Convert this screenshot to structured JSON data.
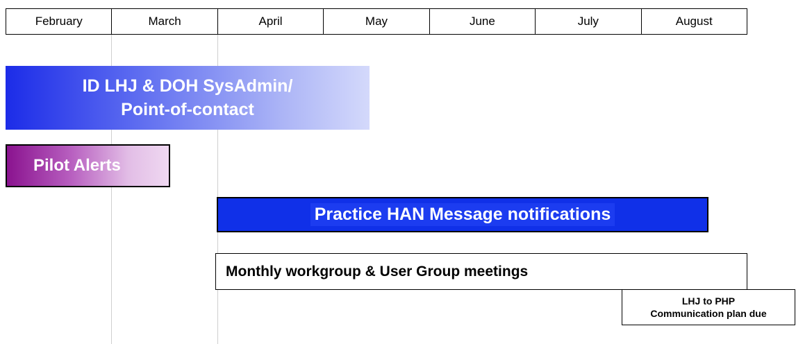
{
  "months": [
    "February",
    "March",
    "April",
    "May",
    "June",
    "July",
    "August"
  ],
  "tasks": {
    "sysadmin": {
      "line1": "ID LHJ & DOH SysAdmin/",
      "line2": "Point-of-contact"
    },
    "pilot": {
      "label": "Pilot Alerts"
    },
    "practice": {
      "label": "Practice HAN Message notifications"
    },
    "monthly": {
      "label": "Monthly workgroup & User Group meetings"
    },
    "communication": {
      "line1": "LHJ to PHP",
      "line2": "Communication plan due"
    }
  },
  "colors": {
    "sysadmin_start": "#1c2ce8",
    "pilot_start": "#8a138f",
    "practice_fill": "#1030e8"
  }
}
